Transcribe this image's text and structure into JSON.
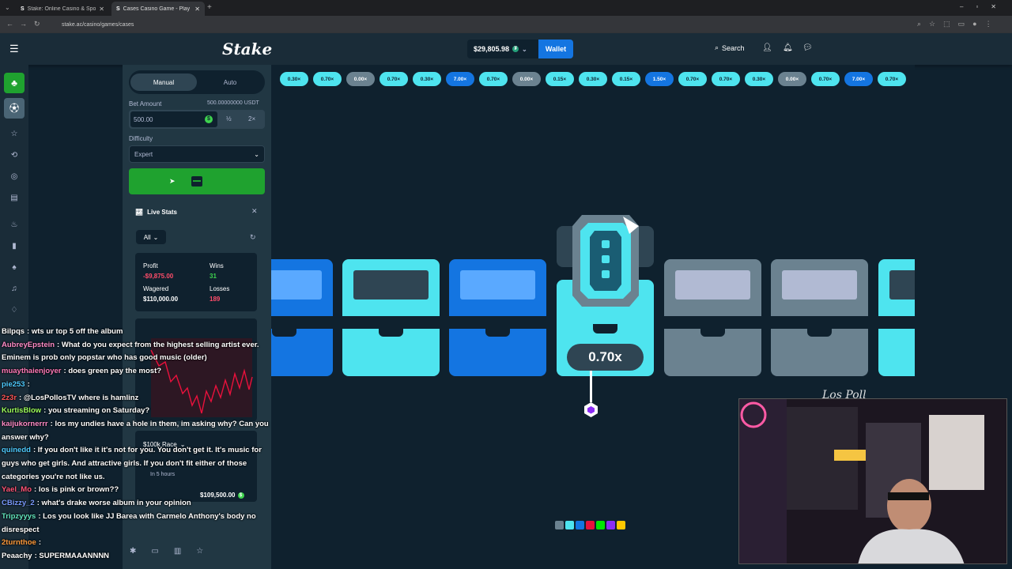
{
  "browser": {
    "tabs": [
      {
        "title": "Stake: Online Casino & Sports B"
      },
      {
        "title": "Cases Casino Game - Play Stake"
      }
    ],
    "url": "stake.ac/casino/games/cases"
  },
  "header": {
    "logo": "Stake",
    "balance": "$29,805.98",
    "wallet_label": "Wallet",
    "search_label": "Search"
  },
  "sidebar": {
    "mode_tabs": [
      "Manual",
      "Auto"
    ],
    "bet_amount_label": "Bet Amount",
    "bet_amount_usdt": "500.00000000 USDT",
    "bet_amount_value": "500.00",
    "half_label": "½",
    "double_label": "2×",
    "difficulty_label": "Difficulty",
    "difficulty_value": "Expert",
    "live_stats": {
      "title": "Live Stats",
      "filter": "All",
      "profit_label": "Profit",
      "profit_value": "-$9,875.00",
      "wins_label": "Wins",
      "wins_value": "31",
      "wagered_label": "Wagered",
      "wagered_value": "$110,000.00",
      "losses_label": "Losses",
      "losses_value": "189"
    },
    "race": {
      "title": "$100k Race",
      "subtitle": "In 5 hours",
      "amount": "$109,500.00"
    }
  },
  "game": {
    "history": [
      "0.30×",
      "0.70×",
      "0.00×",
      "0.70×",
      "0.30×",
      "7.00×",
      "0.70×",
      "0.00×",
      "0.15×",
      "0.30×",
      "0.15×",
      "1.50×",
      "0.70×",
      "0.70×",
      "0.30×",
      "0.00×",
      "0.70×",
      "7.00×",
      "0.70×"
    ],
    "history_colors": [
      "#4ee4ef",
      "#4ee4ef",
      "#6b8290",
      "#4ee4ef",
      "#4ee4ef",
      "#1475e1",
      "#4ee4ef",
      "#6b8290",
      "#4ee4ef",
      "#4ee4ef",
      "#4ee4ef",
      "#1475e1",
      "#4ee4ef",
      "#4ee4ef",
      "#4ee4ef",
      "#6b8290",
      "#4ee4ef",
      "#1475e1",
      "#4ee4ef"
    ],
    "result_multiplier": "0.70x",
    "tier_colors": [
      "#6b8290",
      "#4ee4ef",
      "#1475e1",
      "#e9113c",
      "#00e701",
      "#8b2cf5",
      "#ffc800"
    ]
  },
  "chat": [
    {
      "user": "Bilpqs",
      "color": "#ffffff",
      "msg": "wts ur top 5 off the album"
    },
    {
      "user": "AubreyEpstein",
      "color": "#ff8cc8",
      "msg": "What do you expect from the highest selling artist ever. Eminem is prob only popstar who has good music (older)"
    },
    {
      "user": "muaythaienjoyer",
      "color": "#ff7ab8",
      "msg": "does green pay the most?"
    },
    {
      "user": "pie253",
      "color": "#4ecbff",
      "msg": ""
    },
    {
      "user": "2z3r",
      "color": "#ff5555",
      "msg": "@LosPollosTV where is hamlinz"
    },
    {
      "user": "KurtisBlow",
      "color": "#9dff5c",
      "msg": "you streaming on Saturday?"
    },
    {
      "user": "kaijukornerrr",
      "color": "#ff8cc8",
      "msg": "los my undies have a hole in them, im asking why? Can you answer why?"
    },
    {
      "user": "quinedd",
      "color": "#4ecbff",
      "msg": "If you don't like it it's not for you. You don't get it. It's music for guys who get girls. And attractive girls. If you don't fit either of those categories you're not like us."
    },
    {
      "user": "Yael_Mo",
      "color": "#ff5577",
      "msg": "los is pink or brown??"
    },
    {
      "user": "CBizzy_2",
      "color": "#7a9bff",
      "msg": "what's drake worse album in your opinion"
    },
    {
      "user": "Tripzyyys",
      "color": "#63e6be",
      "msg": "Los you look like JJ Barea with Carmelo Anthony's body no disrespect"
    },
    {
      "user": "2turnthoe",
      "color": "#ff9a3c",
      "msg": ""
    },
    {
      "user": "Peaachy",
      "color": "#ffffff",
      "msg": "SUPERMAAANNNN"
    }
  ]
}
